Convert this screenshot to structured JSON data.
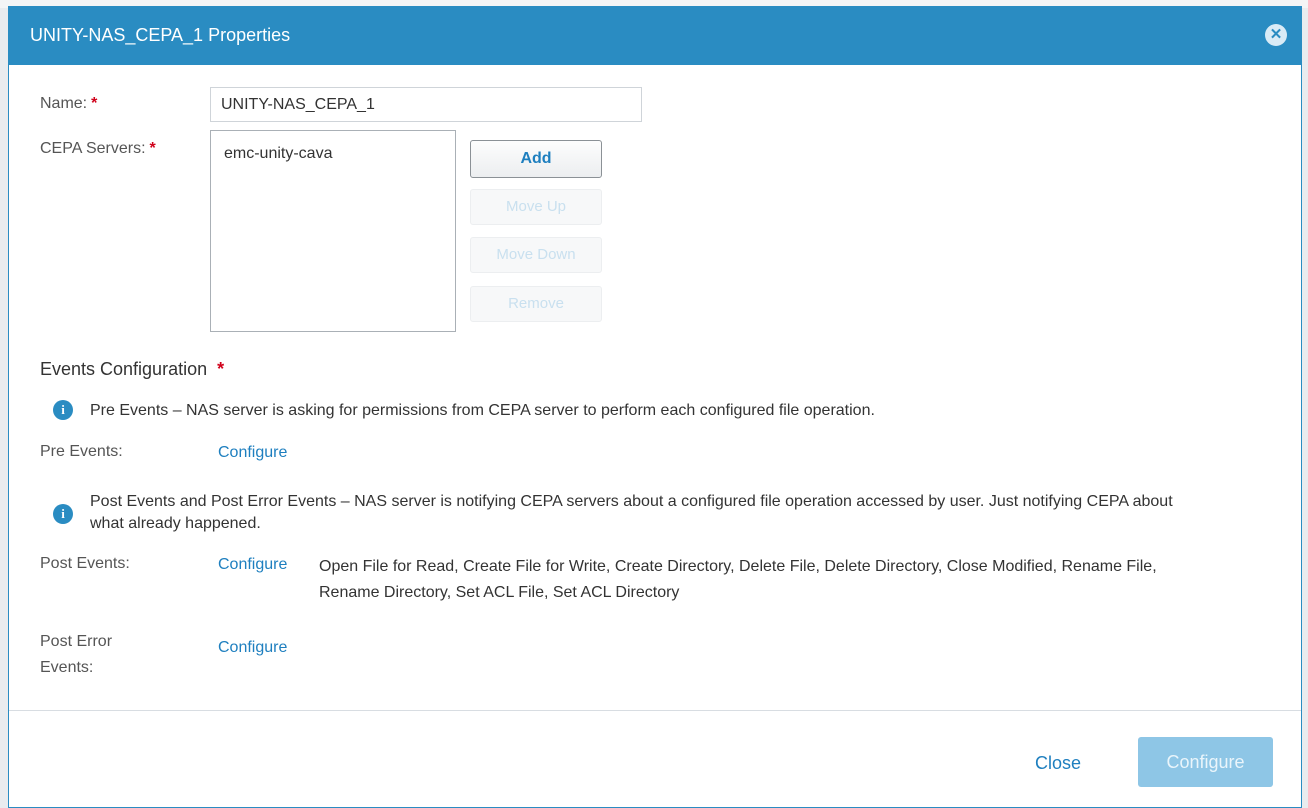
{
  "dialog": {
    "title": "UNITY-NAS_CEPA_1 Properties",
    "close_glyph": "✕"
  },
  "form": {
    "name_label": "Name:",
    "name_value": "UNITY-NAS_CEPA_1",
    "cepa_label": "CEPA Servers:",
    "required_mark": "*",
    "cepa_servers": [
      "emc-unity-cava"
    ]
  },
  "buttons": {
    "add": "Add",
    "move_up": "Move Up",
    "move_down": "Move Down",
    "remove": "Remove"
  },
  "events": {
    "section_title": "Events Configuration",
    "info_glyph": "i",
    "pre_info": "Pre Events – NAS server is asking for permissions from CEPA server to perform each configured file operation.",
    "pre_label": "Pre Events:",
    "pre_link": "Configure",
    "post_info": "Post Events and Post Error Events – NAS server is notifying CEPA servers about a configured file operation accessed by user. Just notifying CEPA about what already happened.",
    "post_label": "Post Events:",
    "post_link": "Configure",
    "post_list": "Open File for Read, Create File for Write, Create Directory, Delete File, Delete Directory, Close Modified, Rename File, Rename Directory, Set ACL File, Set ACL Directory",
    "post_error_label_line1": "Post Error",
    "post_error_label_line2": "Events:",
    "post_error_link": "Configure"
  },
  "footer": {
    "close": "Close",
    "configure": "Configure"
  },
  "colors": {
    "header_bg": "#2a8cc2",
    "link": "#1e7fbf",
    "required": "#d0021b",
    "configure_disabled": "#8ec6e6"
  },
  "icons": {
    "dialog_close": "close-circle-icon",
    "info": "info-icon"
  }
}
